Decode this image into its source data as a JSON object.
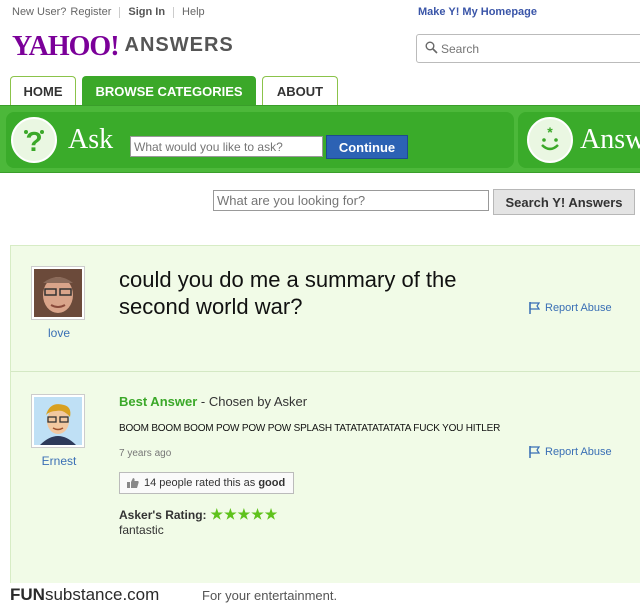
{
  "topnav": {
    "new_user": "New User?",
    "register": "Register",
    "sign_in": "Sign In",
    "help": "Help",
    "homepage": "Make Y! My Homepage"
  },
  "logo": {
    "brand": "YAHOO!",
    "product": "ANSWERS"
  },
  "top_search": {
    "placeholder": "Search"
  },
  "tabs": [
    {
      "label": "HOME"
    },
    {
      "label": "BROWSE CATEGORIES",
      "active": true
    },
    {
      "label": "ABOUT"
    }
  ],
  "ask_bar": {
    "ask_label": "Ask",
    "ask_placeholder": "What would you like to ask?",
    "continue_label": "Continue",
    "answer_label": "Answer"
  },
  "secondary_search": {
    "placeholder": "What are you looking for?",
    "button_label": "Search Y! Answers"
  },
  "question": {
    "asker": "love",
    "text": "could you do me a summary of the second world war?",
    "report_label": "Report Abuse"
  },
  "answer": {
    "answerer": "Ernest",
    "best_label": "Best Answer",
    "chosen_by": " - Chosen by Asker",
    "text": "BOOM BOOM BOOM POW POW POW SPLASH TATATATATATATA  FUCK YOU HITLER",
    "ago": "7 years ago",
    "report_label": "Report Abuse",
    "rated_text": "14 people rated this as",
    "rated_good": "good",
    "asker_rating_label": "Asker's Rating:",
    "rating_stars": 5,
    "stars_text": "★★★★★",
    "rating_comment": "fantastic"
  },
  "footer": {
    "site_bold": "FUN",
    "site_rest": "substance.com",
    "tagline": "For your entertainment."
  },
  "colors": {
    "yahoo_purple": "#7b0099",
    "green": "#4cb83a",
    "link_blue": "#3a6fb5",
    "panel_bg": "#f1fbe7"
  }
}
